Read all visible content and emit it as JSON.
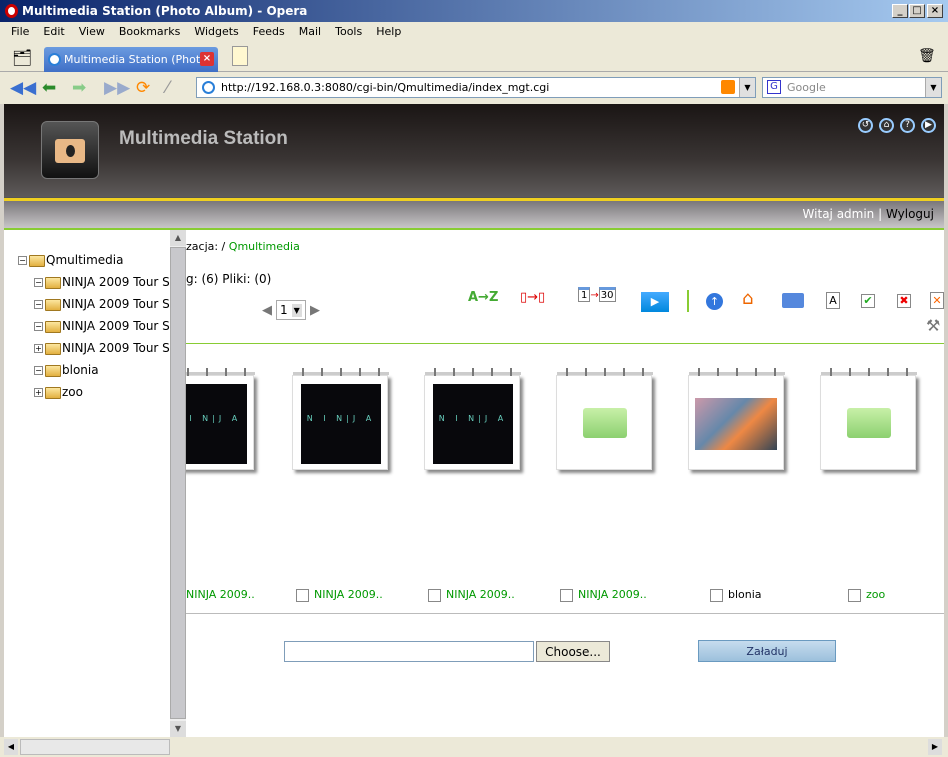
{
  "window": {
    "title": "Multimedia Station (Photo Album) - Opera",
    "min": "_",
    "max": "□",
    "close": "×"
  },
  "menu": [
    "File",
    "Edit",
    "View",
    "Bookmarks",
    "Widgets",
    "Feeds",
    "Mail",
    "Tools",
    "Help"
  ],
  "tab": {
    "label": "Multimedia Station (Phot...",
    "close": "×"
  },
  "nav": {
    "url": "http://192.168.0.3:8080/cgi-bin/Qmultimedia/index_mgt.cgi",
    "search_placeholder": "Google"
  },
  "header": {
    "title": "Multimedia Station",
    "welcome": "Witaj admin",
    "separator": "|",
    "logout": "Wyloguj"
  },
  "sidebar": {
    "root": "Qmultimedia",
    "items": [
      {
        "label": "NINJA 2009 Tour S",
        "expanded": true
      },
      {
        "label": "NINJA 2009 Tour S",
        "expanded": true
      },
      {
        "label": "NINJA 2009 Tour S",
        "expanded": true
      },
      {
        "label": "NINJA 2009 Tour S",
        "expanded": false
      },
      {
        "label": "blonia",
        "expanded": true
      },
      {
        "label": "zoo",
        "expanded": false
      }
    ]
  },
  "main": {
    "location_label": "zacja: /",
    "location_link": "Qmultimedia",
    "counts": "g: (6) Pliki: (0)",
    "page": "1",
    "toolbar": {
      "sort_az": "A→Z",
      "sort_date_from": "1",
      "sort_date_to": "30"
    },
    "items": [
      {
        "label": "NINJA 2009..",
        "type": "ninja"
      },
      {
        "label": "NINJA 2009..",
        "type": "ninja"
      },
      {
        "label": "NINJA 2009..",
        "type": "ninja"
      },
      {
        "label": "NINJA 2009..",
        "type": "folder"
      },
      {
        "label": "blonia",
        "type": "photo"
      },
      {
        "label": "zoo",
        "type": "folder"
      }
    ],
    "ninja_text": "N I N|J A",
    "choose_button": "Choose...",
    "upload_button": "Załaduj",
    "file_input": ""
  },
  "colors": {
    "accent_green": "#009900",
    "header_yellow": "#f0d020"
  }
}
